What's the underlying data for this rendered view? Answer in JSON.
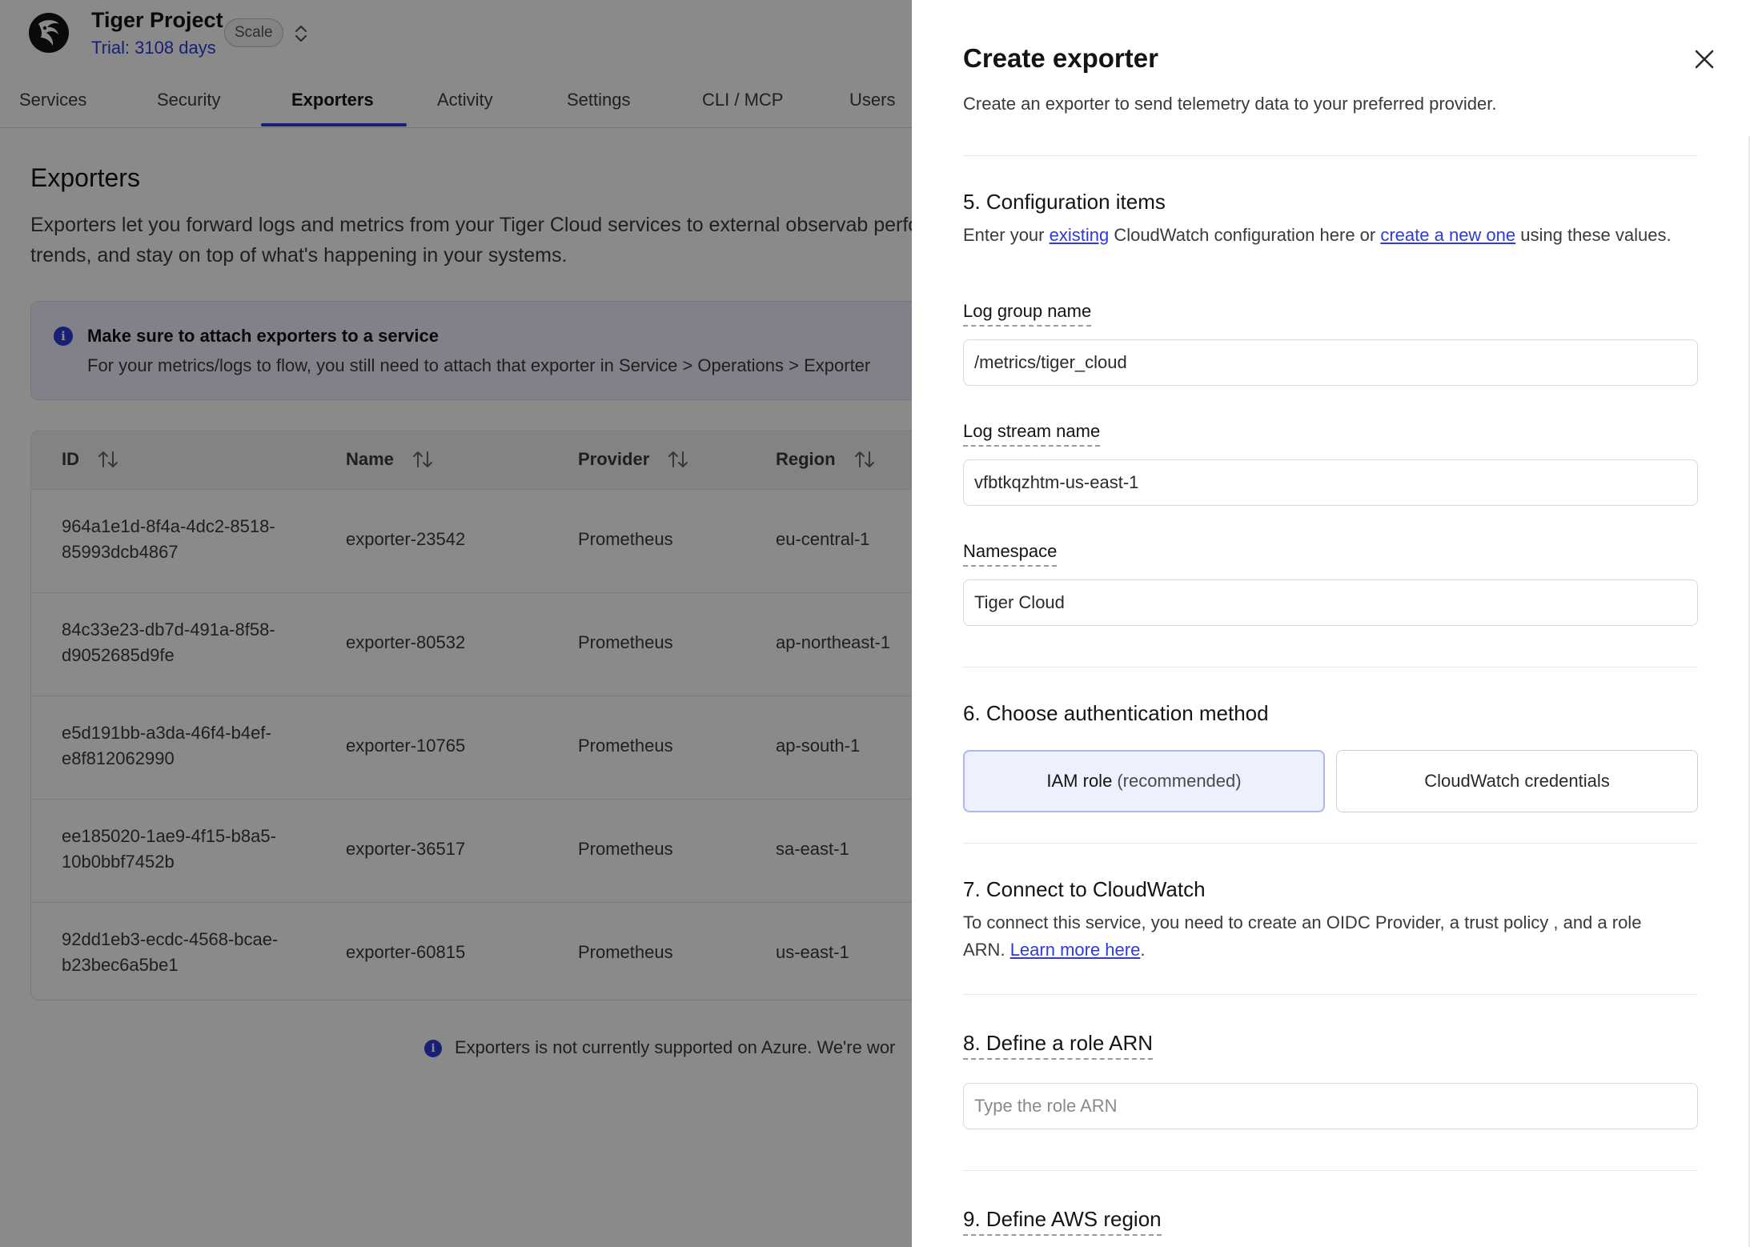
{
  "project": {
    "name": "Tiger Project",
    "trial": "Trial: 3108 days",
    "plan": "Scale"
  },
  "tabs": [
    "Services",
    "Security",
    "Exporters",
    "Activity",
    "Settings",
    "CLI / MCP",
    "Users"
  ],
  "active_tab": "Exporters",
  "main": {
    "title": "Exporters",
    "description": "Exporters let you forward logs and metrics from your Tiger Cloud services to external observab performance, analyze trends, and stay on top of what's happening in your systems.",
    "alert_title": "Make sure to attach exporters to a service",
    "alert_body": "For your metrics/logs to flow, you still need to attach that exporter in Service > Operations > Exporter",
    "footnote": "Exporters is not currently supported on Azure. We're wor"
  },
  "table": {
    "headers": [
      "ID",
      "Name",
      "Provider",
      "Region"
    ],
    "rows": [
      {
        "id": "964a1e1d-8f4a-4dc2-8518-85993dcb4867",
        "name": "exporter-23542",
        "provider": "Prometheus",
        "region": "eu-central-1"
      },
      {
        "id": "84c33e23-db7d-491a-8f58-d9052685d9fe",
        "name": "exporter-80532",
        "provider": "Prometheus",
        "region": "ap-northeast-1"
      },
      {
        "id": "e5d191bb-a3da-46f4-b4ef-e8f812062990",
        "name": "exporter-10765",
        "provider": "Prometheus",
        "region": "ap-south-1"
      },
      {
        "id": "ee185020-1ae9-4f15-b8a5-10b0bbf7452b",
        "name": "exporter-36517",
        "provider": "Prometheus",
        "region": "sa-east-1"
      },
      {
        "id": "92dd1eb3-ecdc-4568-bcae-b23bec6a5be1",
        "name": "exporter-60815",
        "provider": "Prometheus",
        "region": "us-east-1"
      }
    ]
  },
  "drawer": {
    "title": "Create exporter",
    "subtitle": "Create an exporter to send telemetry data to your preferred provider.",
    "config": {
      "title": "5. Configuration items",
      "desc_before": "Enter your ",
      "link_existing": "existing",
      "desc_middle": " CloudWatch configuration here or ",
      "link_create": "create a new one",
      "desc_after": " using these values.",
      "log_group_label": "Log group name",
      "log_group_value": "/metrics/tiger_cloud",
      "log_stream_label": "Log stream name",
      "log_stream_value": "vfbtkqzhtm-us-east-1",
      "namespace_label": "Namespace",
      "namespace_value": "Tiger Cloud"
    },
    "auth": {
      "title": "6. Choose authentication method",
      "option_iam": "IAM role",
      "option_iam_hint": "(recommended)",
      "option_credentials": "CloudWatch credentials",
      "selected": "IAM role"
    },
    "connect": {
      "title": "7. Connect to CloudWatch",
      "desc": "To connect this service, you need to create an OIDC Provider, a trust policy , and a role ARN. ",
      "link": "Learn more here",
      "desc_end": "."
    },
    "role_arn": {
      "title": "8. Define a role ARN",
      "placeholder": "Type the role ARN"
    },
    "region": {
      "title": "9. Define AWS region"
    }
  },
  "colors": {
    "accent": "#2e3bd8",
    "selected_bg": "#eef1fd",
    "selected_border": "#aab7f2",
    "overlay": "rgba(0,0,0,0.46)"
  },
  "icons": [
    "tiger-logo-icon",
    "chevron-up-down-icon",
    "info-icon",
    "sort-icon",
    "close-icon"
  ]
}
